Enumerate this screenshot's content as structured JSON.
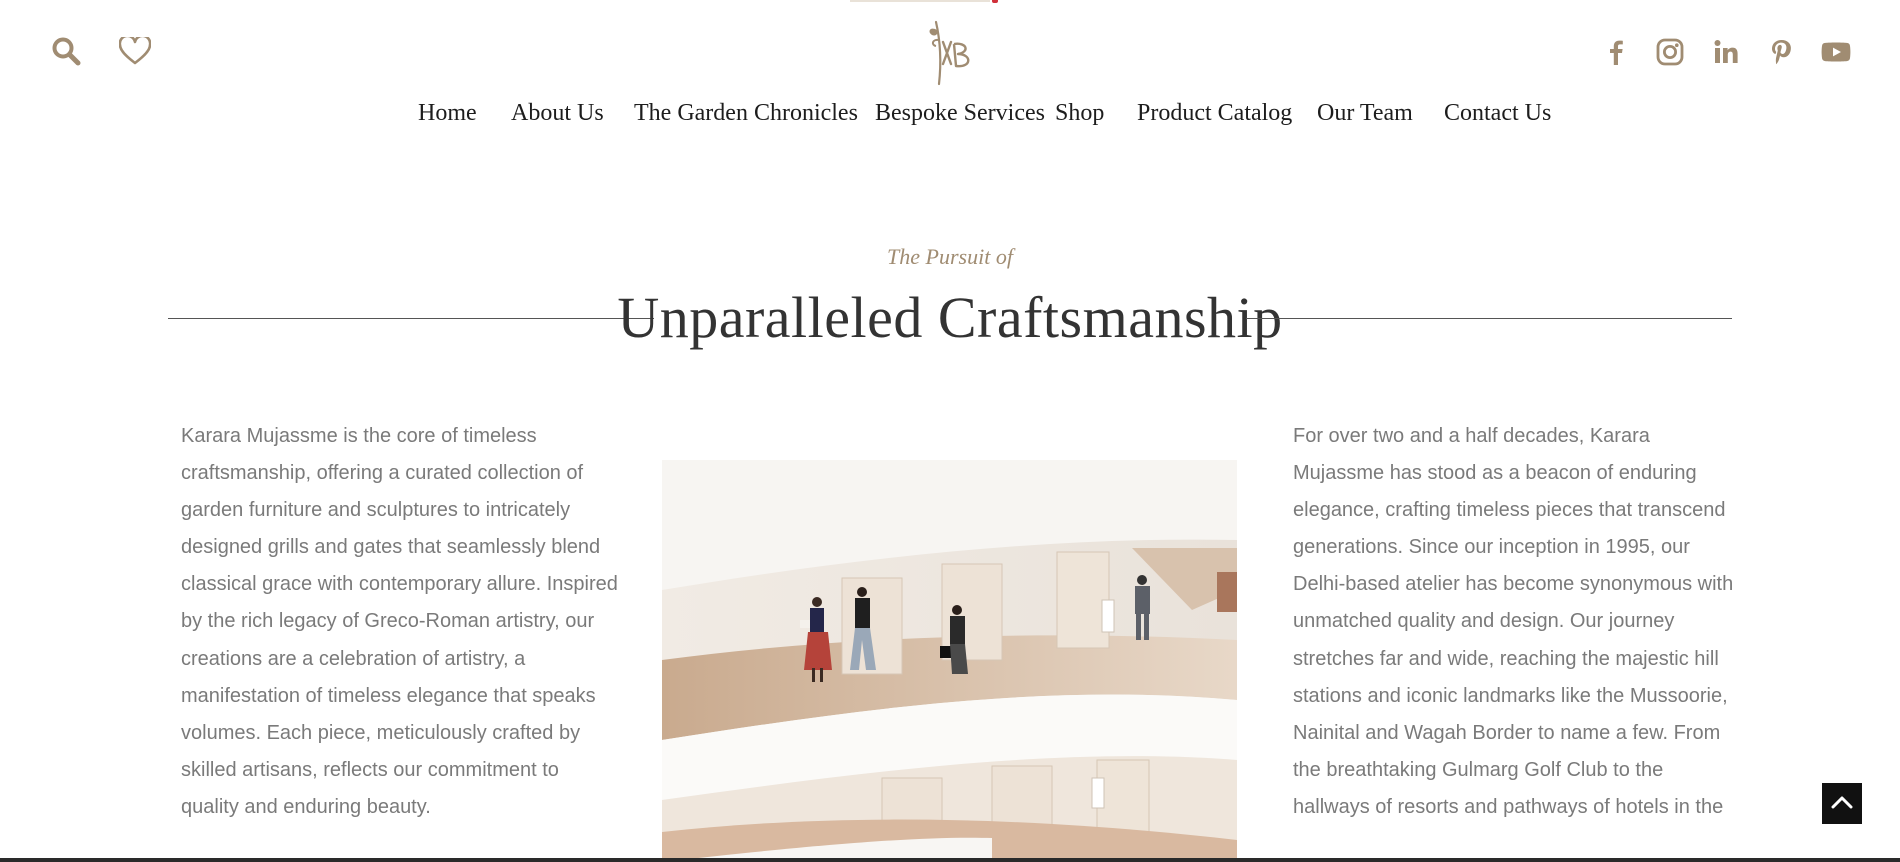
{
  "header": {
    "nav": [
      "Home",
      "About Us",
      "The Garden Chronicles",
      "Bespoke Services",
      "Shop",
      "Product Catalog",
      "Our Team",
      "Contact Us"
    ],
    "icons": {
      "left": [
        "search-icon",
        "heart-icon"
      ],
      "social": [
        "facebook-icon",
        "instagram-icon",
        "linkedin-icon",
        "pinterest-icon",
        "youtube-icon"
      ]
    }
  },
  "section": {
    "kicker": "The Pursuit of",
    "title": "Unparalleled Craftsmanship",
    "left_text": "Karara Mujassme is the core of timeless craftsmanship, offering a curated collection of garden furniture and sculptures to intricately designed grills and gates that seamlessly blend classical grace with contemporary allure. Inspired by the rich legacy of Greco-Roman artistry, our creations are a celebration of artistry, a manifestation of timeless elegance that speaks volumes. Each piece, meticulously crafted by skilled artisans, reflects our commitment to quality and enduring beauty.",
    "right_text": "For over two and a half decades, Karara Mujassme has stood as a beacon of enduring elegance, crafting timeless pieces that transcend generations. Since our inception in 1995, our Delhi-based atelier has become synonymous with unmatched quality and design. Our journey stretches far and wide, reaching the majestic hill stations and iconic landmarks like the Mussoorie, Nainital and Wagah Border to name a few. From the breathtaking Gulmarg Golf Club to the hallways of resorts and pathways of hotels in the"
  },
  "colors": {
    "accent": "#a08c72",
    "icon": "#a08c72",
    "text_body": "#7a7a7a",
    "heading": "#333333",
    "nav_text": "#1d1d1d"
  }
}
